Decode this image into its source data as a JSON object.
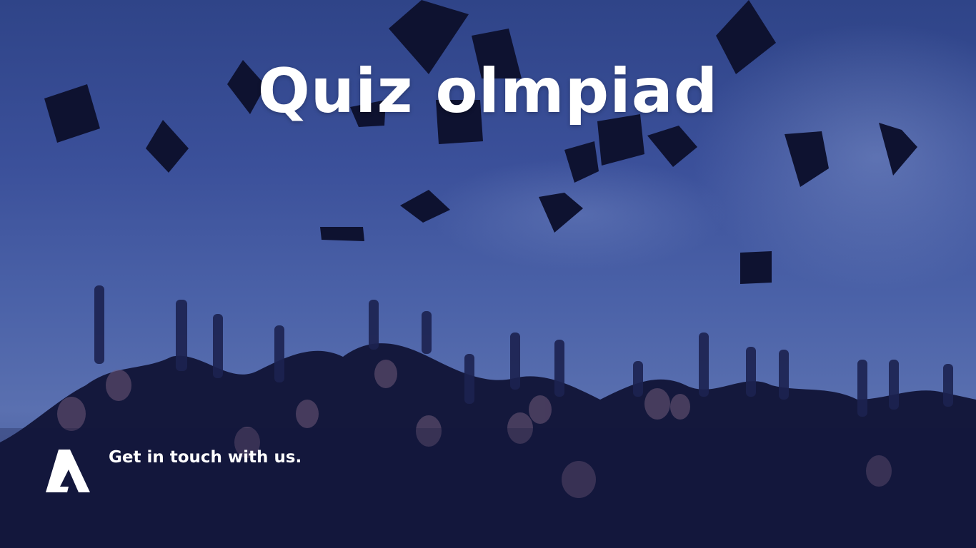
{
  "title": "Quiz olmpiad",
  "cta": {
    "text": "Get in touch with us."
  },
  "icons": {
    "logo": "brand-a-logo"
  },
  "colors": {
    "overlay": "#2e3f86",
    "text": "#ffffff"
  }
}
